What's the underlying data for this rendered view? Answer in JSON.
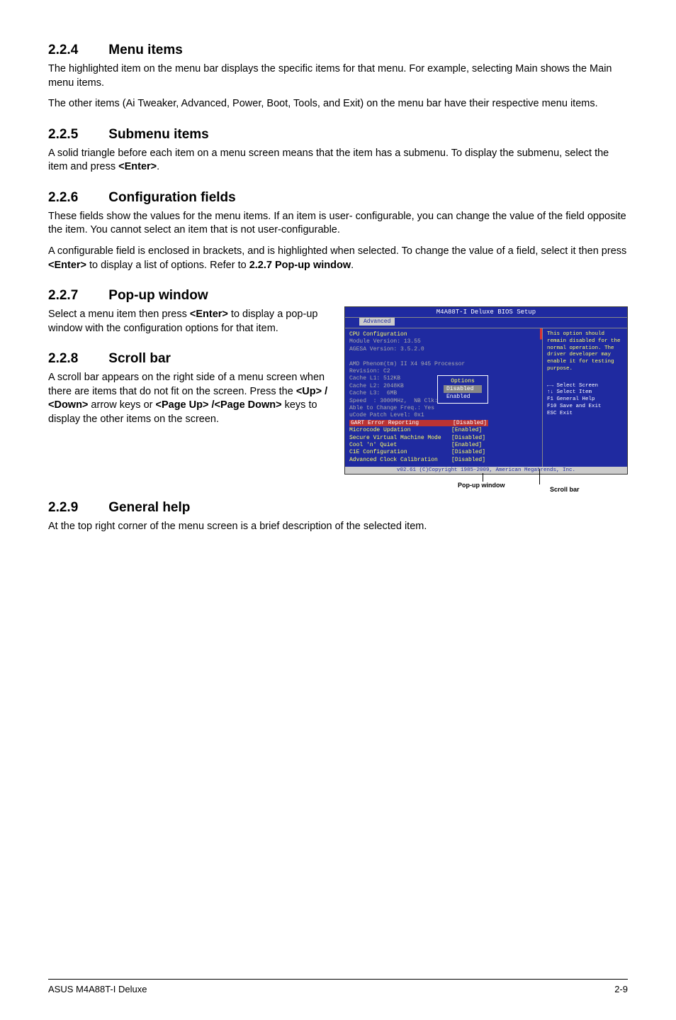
{
  "sections": {
    "menu_items": {
      "num": "2.2.4",
      "title": "Menu items",
      "p1": "The highlighted item on the menu bar displays the specific items for that menu. For example, selecting Main shows the Main menu items.",
      "p2": "The other items (Ai Tweaker, Advanced, Power, Boot, Tools, and Exit) on the menu bar have their respective menu items."
    },
    "submenu": {
      "num": "2.2.5",
      "title": "Submenu items",
      "p1_a": "A solid triangle before each item on a menu screen means that the item has a submenu. To display the submenu, select the item and press ",
      "p1_enter": "<Enter>",
      "p1_b": "."
    },
    "config_fields": {
      "num": "2.2.6",
      "title": "Configuration fields",
      "p1": "These fields show the values for the menu items. If an item is user- configurable, you can change the value of the field opposite the item. You cannot select an item that is not user-configurable.",
      "p2_a": "A configurable field is enclosed in brackets, and is highlighted when selected. To change the value of a field, select it then press ",
      "p2_enter": "<Enter>",
      "p2_b": " to display a list of options. Refer to ",
      "p2_ref": "2.2.7 Pop-up window",
      "p2_c": "."
    },
    "popup": {
      "num": "2.2.7",
      "title": "Pop-up window",
      "p1_a": "Select a menu item then press ",
      "p1_enter": "<Enter>",
      "p1_b": " to display a pop-up window with the configuration options for that item."
    },
    "scrollbar": {
      "num": "2.2.8",
      "title": "Scroll bar",
      "p1_a": "A scroll bar appears on the right side of a menu screen when there are items that do not fit on the screen. Press the ",
      "p1_b": "<Up> / <Down>",
      "p1_c": " arrow keys or ",
      "p1_d": "<Page Up> /<Page Down>",
      "p1_e": " keys to display the other items on the screen."
    },
    "general_help": {
      "num": "2.2.9",
      "title": "General help",
      "p1": "At the top right corner of the menu screen is a brief description of the selected item."
    }
  },
  "bios": {
    "title": "M4A88T-I Deluxe BIOS Setup",
    "tab": "Advanced",
    "header": "CPU Configuration",
    "lines_gray": [
      "Module Version: 13.55",
      "AGESA Version: 3.5.2.0",
      "",
      "AMD Phenom(tm) II X4 945 Processor",
      "Revision: C2",
      "Cache L1: 512KB",
      "Cache L2: 2048KB",
      "Cache L3:  6MB",
      "Speed  : 3000MHz,  NB Clk: 2000MHz",
      "Able to Change Freq.: Yes",
      "uCode Patch Level: 0x1"
    ],
    "highlight": "GART Error Reporting          [Disabled]",
    "lines_yellow": [
      "Microcode Updation            [Enabled]",
      "Secure Virtual Machine Mode   [Disabled]",
      "Cool 'n' Quiet                [Enabled]",
      "C1E Configuration             [Disabled]",
      "Advanced Clock Calibration    [Disabled]"
    ],
    "side_help": "This option should remain disabled for the normal operation. The driver developer may enable it for testing purpose.",
    "nav": {
      "l1": "←→   Select Screen",
      "l2": "↑↓   Select Item",
      "l3": "F1   General Help",
      "l4": "F10  Save and Exit",
      "l5": "ESC  Exit"
    },
    "popup": {
      "title": "Options",
      "opt1": "Disabled",
      "opt2": "Enabled"
    },
    "footer": "v02.61 (C)Copyright 1985-2009, American Megatrends, Inc.",
    "callout_popup": "Pop-up window",
    "callout_scroll": "Scroll bar"
  },
  "footer": {
    "left": "ASUS M4A88T-I Deluxe",
    "right": "2-9"
  }
}
